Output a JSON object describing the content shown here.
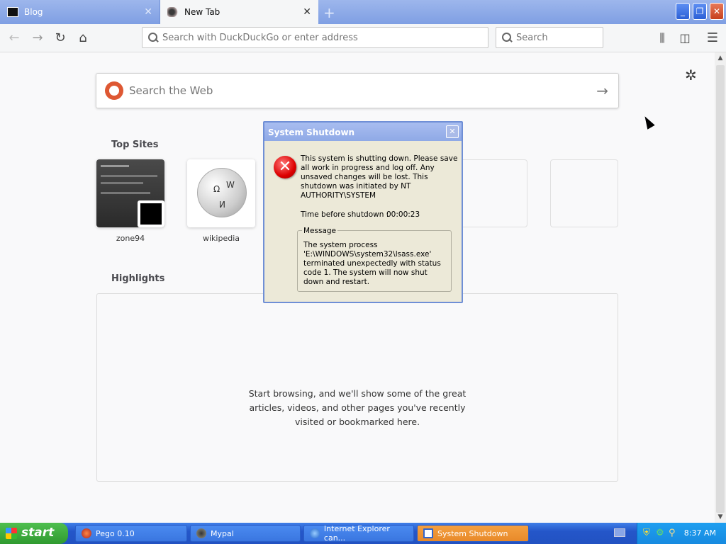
{
  "tabs": [
    {
      "title": "Blog"
    },
    {
      "title": "New Tab"
    }
  ],
  "toolbar": {
    "url_placeholder": "Search with DuckDuckGo or enter address",
    "search_placeholder": "Search"
  },
  "newtab": {
    "websearch_placeholder": "Search the Web",
    "top_sites_title": "Top Sites",
    "top_sites": [
      {
        "label": "zone94"
      },
      {
        "label": "wikipedia"
      }
    ],
    "highlights_title": "Highlights",
    "highlights_empty": "Start browsing, and we'll show some of the great articles, videos, and other pages you've recently visited or bookmarked here."
  },
  "dialog": {
    "title": "System Shutdown",
    "message": "This system is shutting down. Please save all work in progress and log off. Any unsaved changes will be lost. This shutdown was initiated by NT AUTHORITY\\SYSTEM",
    "time_label": "Time before shutdown :",
    "time_value": "00:00:23",
    "field_legend": "Message",
    "field_text": "The system process 'E:\\WINDOWS\\system32\\lsass.exe' terminated unexpectedly with status code 1.  The system will now shut down and restart."
  },
  "taskbar": {
    "start_label": "start",
    "tasks": [
      {
        "label": "Pego 0.10"
      },
      {
        "label": "Mypal"
      },
      {
        "label": "Internet Explorer can..."
      },
      {
        "label": "System Shutdown"
      }
    ],
    "clock": "8:37 AM"
  },
  "colors": {
    "xp_blue": "#2456c9",
    "start_green": "#2f9a2f",
    "error_red": "#d00",
    "ddg_orange": "#de5833"
  }
}
